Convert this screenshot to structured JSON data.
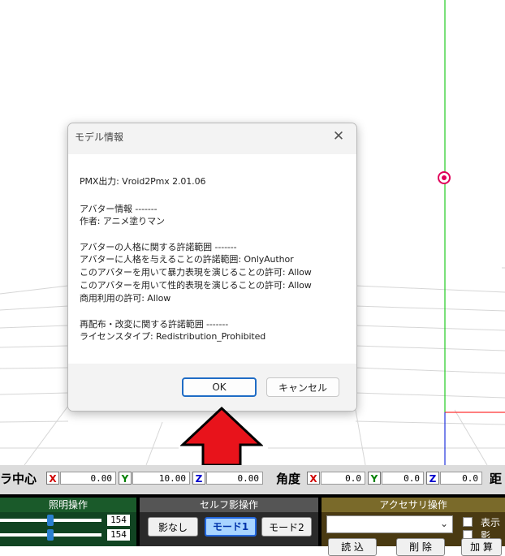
{
  "dialog": {
    "title": "モデル情報",
    "close_glyph": "✕",
    "lines": [
      "PMX出力: Vroid2Pmx 2.01.06",
      "アバター情報 -------",
      "作者: アニメ塗りマン",
      "アバターの人格に関する許諾範囲 -------",
      "アバターに人格を与えることの許諾範囲: OnlyAuthor",
      "このアバターを用いて暴力表現を演じることの許可: Allow",
      "このアバターを用いて性的表現を演じることの許可: Allow",
      "商用利用の許可: Allow",
      "再配布・改変に関する許諾範囲 -------",
      "ライセンスタイプ: Redistribution_Prohibited"
    ],
    "ok_label": "OK",
    "cancel_label": "キャンセル"
  },
  "camera": {
    "label": "ラ中心",
    "x_axis": "X",
    "x_value": "0.00",
    "y_axis": "Y",
    "y_value": "10.00",
    "z_axis": "Z",
    "z_value": "0.00",
    "angle_label": "角度",
    "ax_axis": "X",
    "ax_value": "0.0",
    "ay_axis": "Y",
    "ay_value": "0.0",
    "az_axis": "Z",
    "az_value": "0.0",
    "distance_label": "距"
  },
  "lighting": {
    "title": "照明操作",
    "slider1_value": "154",
    "slider2_value": "154"
  },
  "self_shadow": {
    "collapse": "−",
    "title": "セルフ影操作",
    "btn_none": "影なし",
    "btn_mode1": "モード1",
    "btn_mode2": "モード2"
  },
  "accessory": {
    "collapse": "−",
    "title": "アクセサリ操作",
    "show_label": "表示",
    "shadow_label": "影",
    "load_label": "読 込",
    "delete_label": "削 除",
    "add_label": "加 算"
  },
  "colors": {
    "annotation_arrow": "#e8131b",
    "y_axis_line": "#22cc22",
    "x_axis_line": "#ff3333",
    "z_axis_line": "#2233dd",
    "ok_border": "#1f6cc5"
  },
  "icons": {
    "dialog_close": "close-icon",
    "annotation": "up-arrow-icon",
    "camera_center": "target-marker-icon",
    "dropdown": "chevron-down-icon"
  }
}
